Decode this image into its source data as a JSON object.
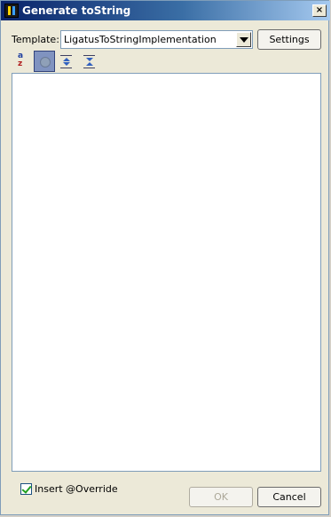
{
  "window": {
    "title": "Generate toString",
    "close_label": "×"
  },
  "template": {
    "label": "Template:",
    "selected": "LigatusToStringImplementation",
    "settings_label": "Settings"
  },
  "toolbar": {
    "sort_alpha_top": "a",
    "sort_alpha_bottom": "z",
    "items": [
      {
        "name": "sort-alphabetically",
        "pressed": false
      },
      {
        "name": "show-inherited",
        "pressed": true
      },
      {
        "name": "expand-all",
        "pressed": false
      },
      {
        "name": "collapse-all",
        "pressed": false
      }
    ]
  },
  "options": {
    "insert_override_label": "Insert @Override",
    "insert_override_checked": true
  },
  "buttons": {
    "ok_label": "OK",
    "ok_enabled": false,
    "cancel_label": "Cancel"
  },
  "members": []
}
